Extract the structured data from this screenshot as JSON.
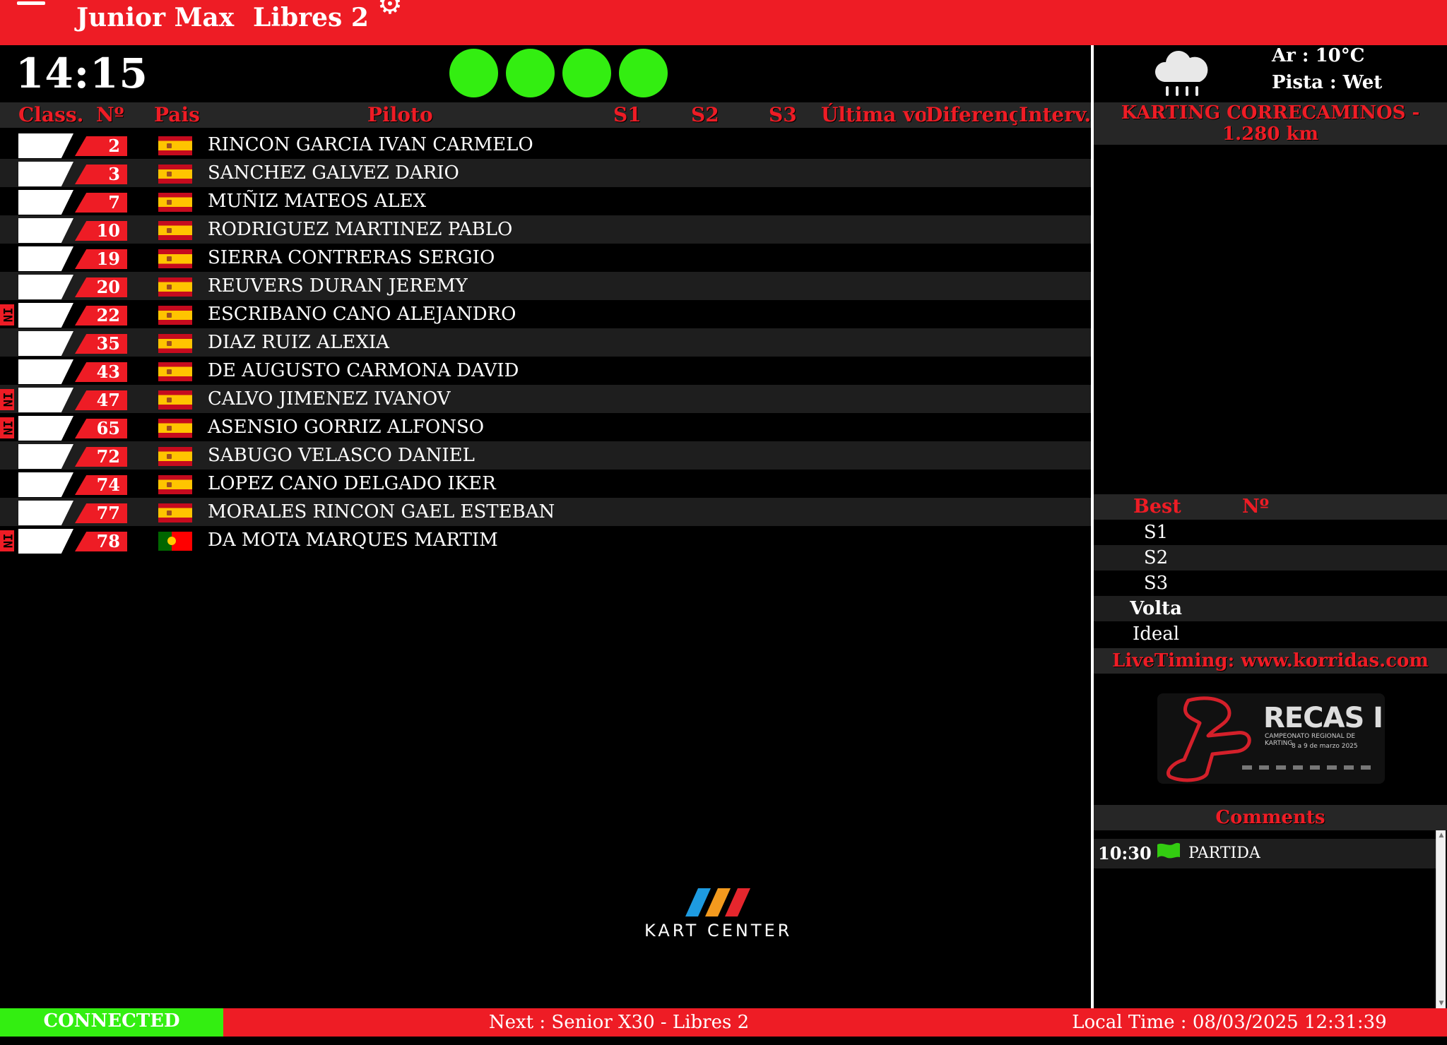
{
  "header": {
    "category": "Junior Max",
    "session": "Libres 2"
  },
  "clock": "14:15",
  "lights": {
    "count": 4,
    "color": "#33ee11"
  },
  "table": {
    "headers": {
      "class": "Class.",
      "num": "Nº",
      "country": "Pais",
      "driver": "Piloto",
      "s1": "S1",
      "s2": "S2",
      "s3": "S3",
      "last": "Última vol",
      "diff": "Diferenç",
      "interval": "Interv."
    },
    "rows": [
      {
        "num": "2",
        "flag": "es",
        "name": "RINCON GARCIA IVAN CARMELO",
        "in": ""
      },
      {
        "num": "3",
        "flag": "es",
        "name": "SANCHEZ GALVEZ DARIO",
        "in": ""
      },
      {
        "num": "7",
        "flag": "es",
        "name": "MUÑIZ MATEOS ALEX",
        "in": ""
      },
      {
        "num": "10",
        "flag": "es",
        "name": "RODRIGUEZ MARTINEZ PABLO",
        "in": ""
      },
      {
        "num": "19",
        "flag": "es",
        "name": "SIERRA CONTRERAS SERGIO",
        "in": ""
      },
      {
        "num": "20",
        "flag": "es",
        "name": "REUVERS DURAN JEREMY",
        "in": ""
      },
      {
        "num": "22",
        "flag": "es",
        "name": "ESCRIBANO CANO ALEJANDRO",
        "in": "IN"
      },
      {
        "num": "35",
        "flag": "es",
        "name": "DIAZ RUIZ ALEXIA",
        "in": ""
      },
      {
        "num": "43",
        "flag": "es",
        "name": "DE AUGUSTO CARMONA DAVID",
        "in": ""
      },
      {
        "num": "47",
        "flag": "es",
        "name": "CALVO JIMENEZ IVANOV",
        "in": "IN"
      },
      {
        "num": "65",
        "flag": "es",
        "name": "ASENSIO GORRIZ ALFONSO",
        "in": "IN"
      },
      {
        "num": "72",
        "flag": "es",
        "name": "SABUGO VELASCO DANIEL",
        "in": ""
      },
      {
        "num": "74",
        "flag": "es",
        "name": "LOPEZ CANO DELGADO IKER",
        "in": ""
      },
      {
        "num": "77",
        "flag": "es",
        "name": "MORALES RINCON GAEL ESTEBAN",
        "in": ""
      },
      {
        "num": "78",
        "flag": "pt",
        "name": "DA MOTA MARQUES MARTIM",
        "in": "IN"
      }
    ]
  },
  "weather": {
    "icon": "rain-cloud-icon",
    "air": "Ar : 10°C",
    "track": "Pista : Wet"
  },
  "track_name": "KARTING CORRECAMINOS - 1.280 km",
  "best": {
    "header_best": "Best",
    "header_num": "Nº",
    "rows": [
      "S1",
      "S2",
      "S3",
      "Volta",
      "Ideal"
    ]
  },
  "livetiming": "LiveTiming: www.korridas.com",
  "banner": {
    "title": "RECAS I",
    "subtitle": "CAMPEONATO REGIONAL DE KARTING",
    "date": "8 a 9 de marzo 2025"
  },
  "comments": {
    "title": "Comments",
    "items": [
      {
        "time": "10:30",
        "flag": "green-flag-icon",
        "text": "PARTIDA"
      }
    ]
  },
  "logo": "KART CENTER",
  "footer": {
    "status": "CONNECTED",
    "next": "Next : Senior X30 - Libres 2",
    "local_time": "Local Time : 08/03/2025 12:31:39"
  },
  "colors": {
    "brand_red": "#ee1c25",
    "connected_green": "#33ee11",
    "background": "#000000"
  }
}
